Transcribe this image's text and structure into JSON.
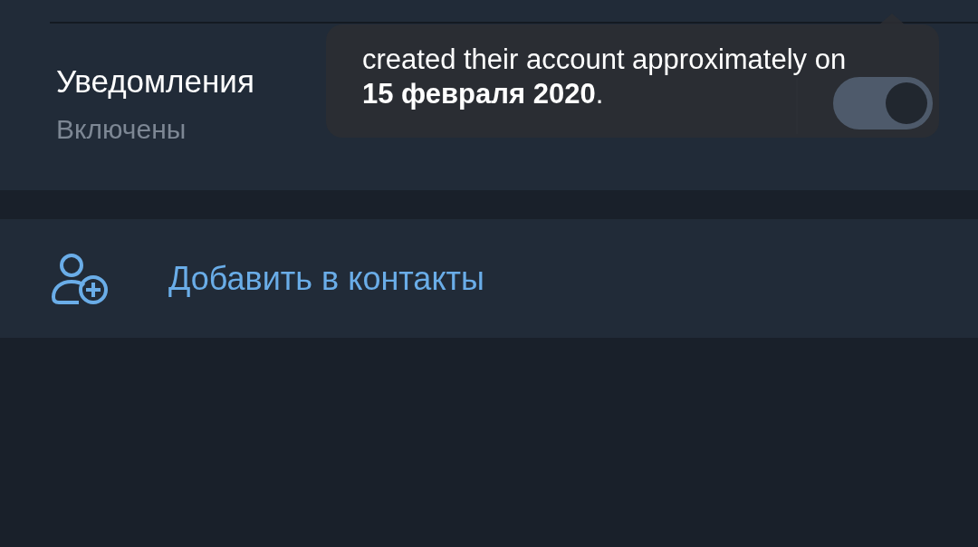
{
  "notifications": {
    "label": "Уведомления",
    "status": "Включены",
    "on": true
  },
  "tooltip": {
    "text": "created their account approximately on **15 февраля 2020**."
  },
  "actions": [
    {
      "label": "Добавить в контакты"
    }
  ]
}
